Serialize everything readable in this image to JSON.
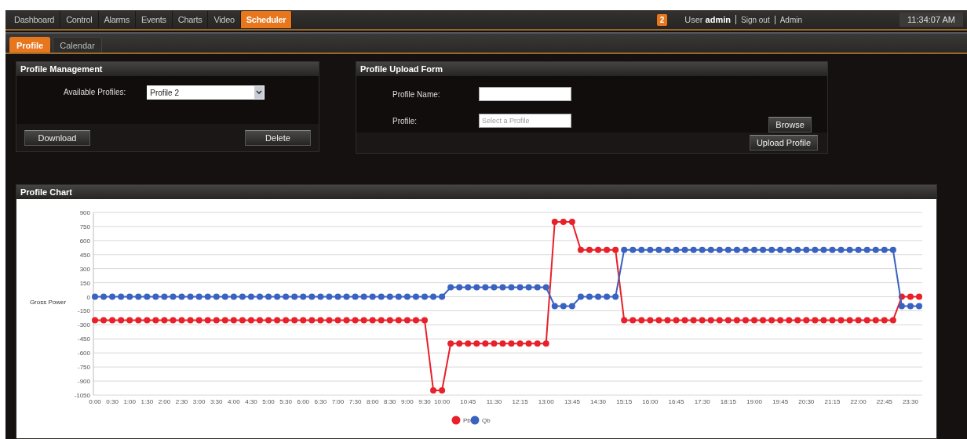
{
  "nav_tabs": [
    {
      "label": "Dashboard",
      "selected": false
    },
    {
      "label": "Control",
      "selected": false
    },
    {
      "label": "Alarms",
      "selected": false
    },
    {
      "label": "Events",
      "selected": false
    },
    {
      "label": "Charts",
      "selected": false
    },
    {
      "label": "Video",
      "selected": false
    },
    {
      "label": "Scheduler",
      "selected": true
    }
  ],
  "header": {
    "alert_count": "2",
    "user": "User **admin**",
    "links": [
      "Sign out",
      "Admin"
    ],
    "clock": "11:34:07 AM"
  },
  "sub_tabs": [
    {
      "label": "Profile",
      "selected": true
    },
    {
      "label": "Calendar",
      "selected": false
    }
  ],
  "profile_management": {
    "title": "Profile Management",
    "label": "Available Profiles:",
    "select_value": "Profile 2",
    "buttons": [
      "Download",
      "Delete"
    ]
  },
  "profile_upload_form": {
    "title": "Profile Upload Form",
    "name_label": "Profile Name:",
    "profile_label": "Profile:",
    "profile_placeholder": "Select a Profile",
    "browse_button": "Browse",
    "upload_button": "Upload Profile"
  },
  "profile_chart": {
    "title": "Profile Chart",
    "chart_data": {
      "type": "line",
      "ylabel": "Gross Power",
      "ylim": [
        -1050,
        900
      ],
      "yticks": [
        900,
        750,
        600,
        450,
        300,
        150,
        0,
        -150,
        -300,
        -450,
        -600,
        -750,
        -900,
        -1050
      ],
      "grid": true,
      "legend": "bottom",
      "xlim": [
        0,
        1425
      ],
      "x": [
        0,
        15,
        30,
        45,
        60,
        75,
        90,
        105,
        120,
        135,
        150,
        165,
        180,
        195,
        210,
        225,
        240,
        255,
        270,
        285,
        300,
        315,
        330,
        345,
        360,
        375,
        390,
        405,
        420,
        435,
        450,
        465,
        480,
        495,
        510,
        525,
        540,
        555,
        570,
        585,
        600,
        615,
        630,
        645,
        660,
        675,
        690,
        705,
        720,
        735,
        750,
        765,
        780,
        795,
        810,
        825,
        840,
        855,
        870,
        885,
        900,
        915,
        930,
        945,
        960,
        975,
        990,
        1005,
        1020,
        1035,
        1050,
        1065,
        1080,
        1095,
        1110,
        1125,
        1140,
        1155,
        1170,
        1185,
        1200,
        1215,
        1230,
        1245,
        1260,
        1275,
        1290,
        1305,
        1320,
        1335,
        1350,
        1365,
        1380,
        1395,
        1410,
        1425
      ],
      "xticks": [
        {
          "value": 0,
          "label": "0:00"
        },
        {
          "value": 30,
          "label": "0:30"
        },
        {
          "value": 60,
          "label": "1:00"
        },
        {
          "value": 90,
          "label": "1:30"
        },
        {
          "value": 120,
          "label": "2:00"
        },
        {
          "value": 150,
          "label": "2:30"
        },
        {
          "value": 180,
          "label": "3:00"
        },
        {
          "value": 210,
          "label": "3:30"
        },
        {
          "value": 240,
          "label": "4:00"
        },
        {
          "value": 270,
          "label": "4:30"
        },
        {
          "value": 300,
          "label": "5:00"
        },
        {
          "value": 330,
          "label": "5:30"
        },
        {
          "value": 360,
          "label": "6:00"
        },
        {
          "value": 390,
          "label": "6:30"
        },
        {
          "value": 420,
          "label": "7:00"
        },
        {
          "value": 450,
          "label": "7:30"
        },
        {
          "value": 480,
          "label": "8:00"
        },
        {
          "value": 510,
          "label": "8:30"
        },
        {
          "value": 540,
          "label": "9:00"
        },
        {
          "value": 570,
          "label": "9:30"
        },
        {
          "value": 600,
          "label": "10:00"
        },
        {
          "value": 645,
          "label": "10:45"
        },
        {
          "value": 690,
          "label": "11:30"
        },
        {
          "value": 735,
          "label": "12:15"
        },
        {
          "value": 780,
          "label": "13:00"
        },
        {
          "value": 825,
          "label": "13:45"
        },
        {
          "value": 870,
          "label": "14:30"
        },
        {
          "value": 915,
          "label": "15:15"
        },
        {
          "value": 960,
          "label": "16:00"
        },
        {
          "value": 1005,
          "label": "16:45"
        },
        {
          "value": 1050,
          "label": "17:30"
        },
        {
          "value": 1095,
          "label": "18:15"
        },
        {
          "value": 1140,
          "label": "19:00"
        },
        {
          "value": 1185,
          "label": "19:45"
        },
        {
          "value": 1230,
          "label": "20:30"
        },
        {
          "value": 1275,
          "label": "21:15"
        },
        {
          "value": 1320,
          "label": "22:00"
        },
        {
          "value": 1365,
          "label": "22:45"
        },
        {
          "value": 1410,
          "label": "23:30"
        }
      ],
      "series": [
        {
          "name": "Pb",
          "color": "#e8202a",
          "marker": "circle",
          "values": [
            -250,
            -250,
            -250,
            -250,
            -250,
            -250,
            -250,
            -250,
            -250,
            -250,
            -250,
            -250,
            -250,
            -250,
            -250,
            -250,
            -250,
            -250,
            -250,
            -250,
            -250,
            -250,
            -250,
            -250,
            -250,
            -250,
            -250,
            -250,
            -250,
            -250,
            -250,
            -250,
            -250,
            -250,
            -250,
            -250,
            -250,
            -250,
            -250,
            -1000,
            -1000,
            -500,
            -500,
            -500,
            -500,
            -500,
            -500,
            -500,
            -500,
            -500,
            -500,
            -500,
            -500,
            800,
            800,
            800,
            500,
            500,
            500,
            500,
            500,
            -250,
            -250,
            -250,
            -250,
            -250,
            -250,
            -250,
            -250,
            -250,
            -250,
            -250,
            -250,
            -250,
            -250,
            -250,
            -250,
            -250,
            -250,
            -250,
            -250,
            -250,
            -250,
            -250,
            -250,
            -250,
            -250,
            -250,
            -250,
            -250,
            -250,
            -250,
            -250,
            0,
            0,
            0
          ]
        },
        {
          "name": "Qb",
          "color": "#3a62c0",
          "marker": "circle",
          "values": [
            0,
            0,
            0,
            0,
            0,
            0,
            0,
            0,
            0,
            0,
            0,
            0,
            0,
            0,
            0,
            0,
            0,
            0,
            0,
            0,
            0,
            0,
            0,
            0,
            0,
            0,
            0,
            0,
            0,
            0,
            0,
            0,
            0,
            0,
            0,
            0,
            0,
            0,
            0,
            0,
            0,
            100,
            100,
            100,
            100,
            100,
            100,
            100,
            100,
            100,
            100,
            100,
            100,
            -100,
            -100,
            -100,
            0,
            0,
            0,
            0,
            0,
            500,
            500,
            500,
            500,
            500,
            500,
            500,
            500,
            500,
            500,
            500,
            500,
            500,
            500,
            500,
            500,
            500,
            500,
            500,
            500,
            500,
            500,
            500,
            500,
            500,
            500,
            500,
            500,
            500,
            500,
            500,
            500,
            -100,
            -100,
            -100
          ]
        }
      ]
    }
  }
}
